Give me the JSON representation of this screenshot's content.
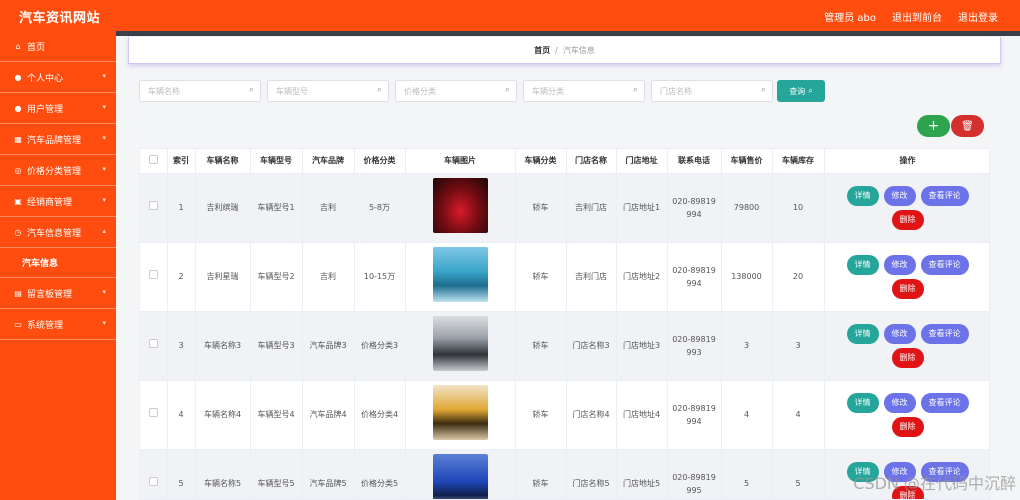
{
  "header": {
    "title": "汽车资讯网站",
    "links": [
      "管理员 abo",
      "退出到前台",
      "退出登录"
    ]
  },
  "sidebar": {
    "items": [
      {
        "label": "首页",
        "icon": "home-icon",
        "glyph": "⌂"
      },
      {
        "label": "个人中心",
        "icon": "user-icon",
        "glyph": "●"
      },
      {
        "label": "用户管理",
        "icon": "user-icon",
        "glyph": "●"
      },
      {
        "label": "汽车品牌管理",
        "icon": "building-icon",
        "glyph": "▦"
      },
      {
        "label": "价格分类管理",
        "icon": "tag-icon",
        "glyph": "◎"
      },
      {
        "label": "经销商管理",
        "icon": "dealer-icon",
        "glyph": "▣"
      },
      {
        "label": "汽车信息管理",
        "icon": "clock-icon",
        "glyph": "◷"
      },
      {
        "label": "留言板管理",
        "icon": "message-icon",
        "glyph": "▤"
      },
      {
        "label": "系统管理",
        "icon": "settings-icon",
        "glyph": "▭"
      }
    ],
    "active_sub": "汽车信息"
  },
  "breadcrumb": {
    "home": "首页",
    "separator": "/",
    "current": "汽车信息"
  },
  "search": {
    "placeholders": [
      "车辆名称",
      "车辆型号",
      "价格分类",
      "车辆分类",
      "门店名称"
    ],
    "button_label": "查询"
  },
  "table": {
    "headers": [
      "",
      "索引",
      "车辆名称",
      "车辆型号",
      "汽车品牌",
      "价格分类",
      "车辆图片",
      "车辆分类",
      "门店名称",
      "门店地址",
      "联系电话",
      "车辆售价",
      "车辆库存",
      "操作"
    ],
    "actions": {
      "detail": "详情",
      "edit": "修改",
      "review": "查看评论",
      "delete": "删除"
    },
    "rows": [
      {
        "index": "1",
        "name": "吉利缤瑞",
        "model": "车辆型号1",
        "brand": "吉利",
        "price_cat": "5-8万",
        "category": "轿车",
        "store": "吉利门店",
        "address": "门店地址1",
        "phone_a": "020-89819",
        "phone_b": "994",
        "price": "79800",
        "stock": "10"
      },
      {
        "index": "2",
        "name": "吉利星瑞",
        "model": "车辆型号2",
        "brand": "吉利",
        "price_cat": "10-15万",
        "category": "轿车",
        "store": "吉利门店",
        "address": "门店地址2",
        "phone_a": "020-89819",
        "phone_b": "994",
        "price": "138000",
        "stock": "20"
      },
      {
        "index": "3",
        "name": "车辆名称3",
        "model": "车辆型号3",
        "brand": "汽车品牌3",
        "price_cat": "价格分类3",
        "category": "轿车",
        "store": "门店名称3",
        "address": "门店地址3",
        "phone_a": "020-89819",
        "phone_b": "993",
        "price": "3",
        "stock": "3"
      },
      {
        "index": "4",
        "name": "车辆名称4",
        "model": "车辆型号4",
        "brand": "汽车品牌4",
        "price_cat": "价格分类4",
        "category": "轿车",
        "store": "门店名称4",
        "address": "门店地址4",
        "phone_a": "020-89819",
        "phone_b": "994",
        "price": "4",
        "stock": "4"
      },
      {
        "index": "5",
        "name": "车辆名称5",
        "model": "车辆型号5",
        "brand": "汽车品牌5",
        "price_cat": "价格分类5",
        "category": "轿车",
        "store": "门店名称5",
        "address": "门店地址5",
        "phone_a": "020-89819",
        "phone_b": "995",
        "price": "5",
        "stock": "5"
      }
    ]
  },
  "colors": {
    "brand_orange": "#ff4d0f",
    "teal": "#26a69a",
    "indigo": "#6c72e8",
    "red": "#e01414",
    "green": "#2ea44f"
  },
  "watermark": "CSDN @在代码中沉醉"
}
